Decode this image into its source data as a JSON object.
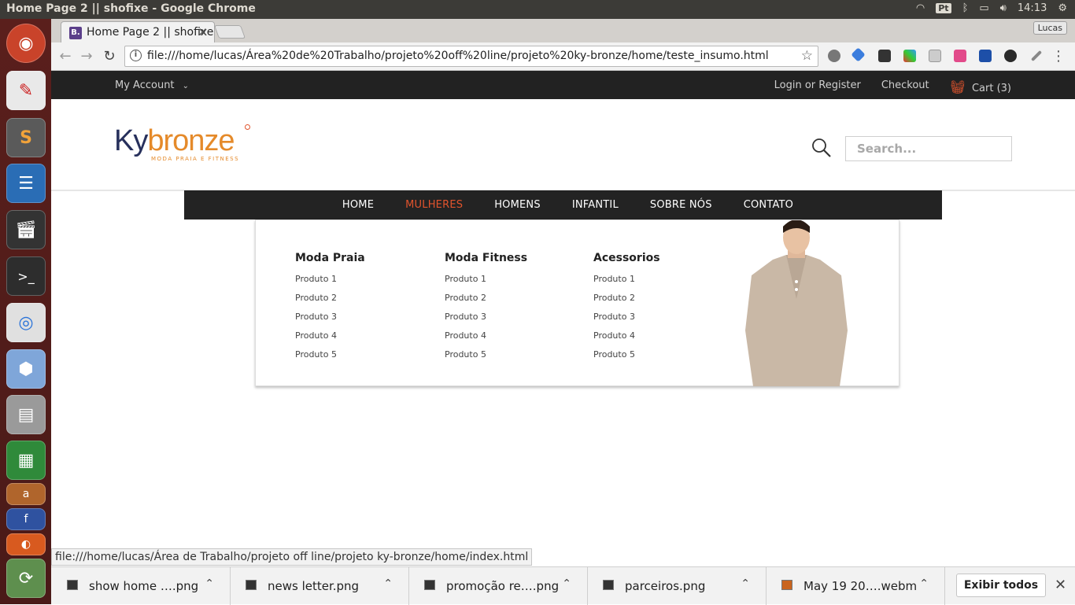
{
  "os": {
    "window_title": "Home Page 2 || shofixe - Google Chrome",
    "keyboard": "Pt",
    "clock": "14:13"
  },
  "browser": {
    "tab_title": "Home Page 2 || shofixe",
    "tab_favicon": "B.",
    "profile": "Lucas",
    "url": "file:///home/lucas/Área%20de%20Trabalho/projeto%20off%20line/projeto%20ky-bronze/home/teste_insumo.html",
    "status_url": "file:///home/lucas/Área de Trabalho/projeto off line/projeto ky-bronze/home/index.html"
  },
  "site": {
    "topbar": {
      "account": "My Account",
      "login": "Login or Register",
      "checkout": "Checkout",
      "cart": "Cart (3)"
    },
    "logo": {
      "ky": "Ky",
      "bronze": "bronze",
      "tagline": "MODA PRAIA E FITNESS"
    },
    "search": {
      "placeholder": "Search..."
    },
    "nav": [
      "HOME",
      "MULHERES",
      "HOMENS",
      "INFANTIL",
      "SOBRE NÓS",
      "CONTATO"
    ],
    "nav_active": "MULHERES",
    "mega": [
      {
        "title": "Moda Praia",
        "items": [
          "Produto 1",
          "Produto 2",
          "Produto 3",
          "Produto 4",
          "Produto 5"
        ]
      },
      {
        "title": "Moda Fitness",
        "items": [
          "Produto 1",
          "Produto 2",
          "Produto 3",
          "Produto 4",
          "Produto 5"
        ]
      },
      {
        "title": "Acessorios",
        "items": [
          "Produto 1",
          "Produto 2",
          "Produto 3",
          "Produto 4",
          "Produto 5"
        ]
      }
    ]
  },
  "downloads": {
    "items": [
      "show home ….png",
      "news letter.png",
      "promoção re….png",
      "parceiros.png",
      "May 19 20….webm"
    ],
    "show_all": "Exibir todos"
  },
  "colors": {
    "accent": "#e1542d",
    "dark_bar": "#222222"
  }
}
